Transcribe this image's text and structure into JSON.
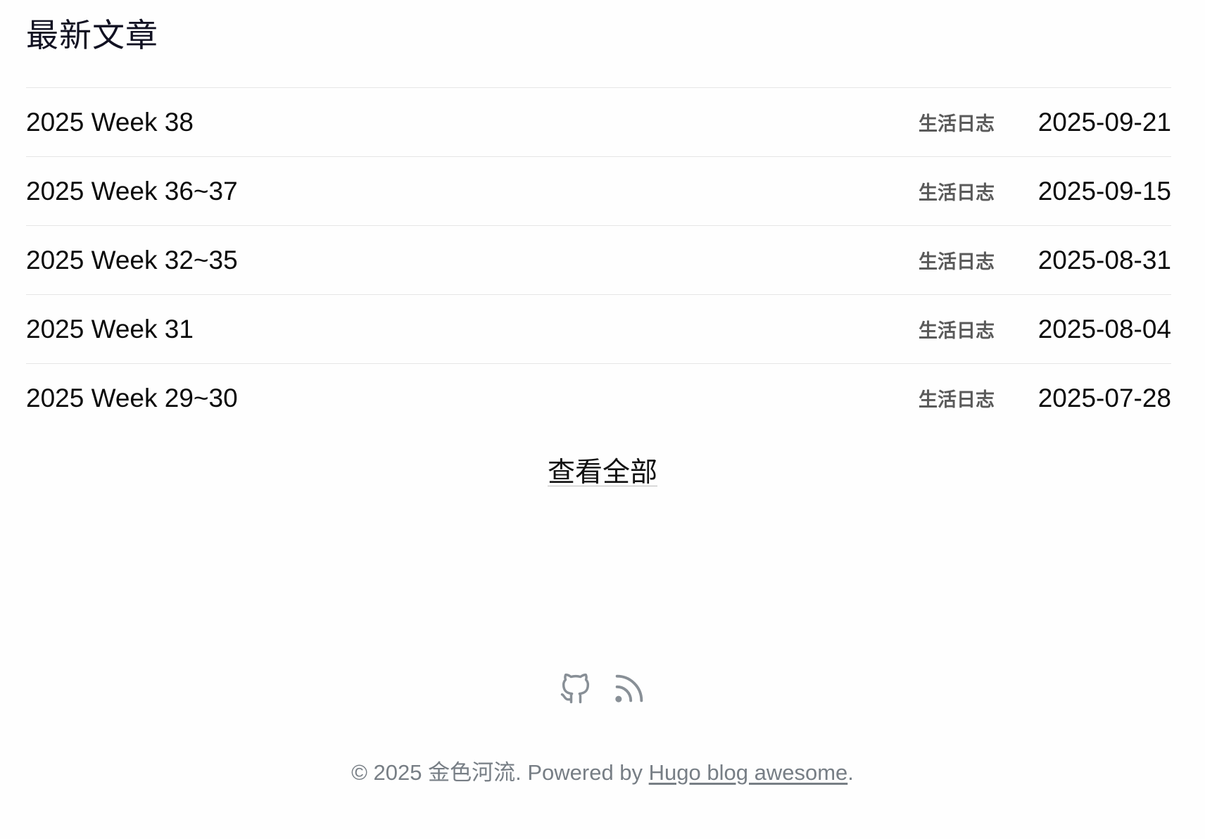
{
  "section": {
    "title": "最新文章"
  },
  "posts": [
    {
      "title": "2025 Week 38",
      "category": "生活日志",
      "date": "2025-09-21"
    },
    {
      "title": "2025 Week 36~37",
      "category": "生活日志",
      "date": "2025-09-15"
    },
    {
      "title": "2025 Week 32~35",
      "category": "生活日志",
      "date": "2025-08-31"
    },
    {
      "title": "2025 Week 31",
      "category": "生活日志",
      "date": "2025-08-04"
    },
    {
      "title": "2025 Week 29~30",
      "category": "生活日志",
      "date": "2025-07-28"
    }
  ],
  "view_all_label": "查看全部",
  "social": {
    "icons": [
      "github-icon",
      "rss-icon"
    ],
    "icon_color": "#888f96"
  },
  "footer": {
    "prefix": "© 2025 金色河流. Powered by ",
    "link_text": "Hugo blog awesome",
    "suffix": "."
  }
}
